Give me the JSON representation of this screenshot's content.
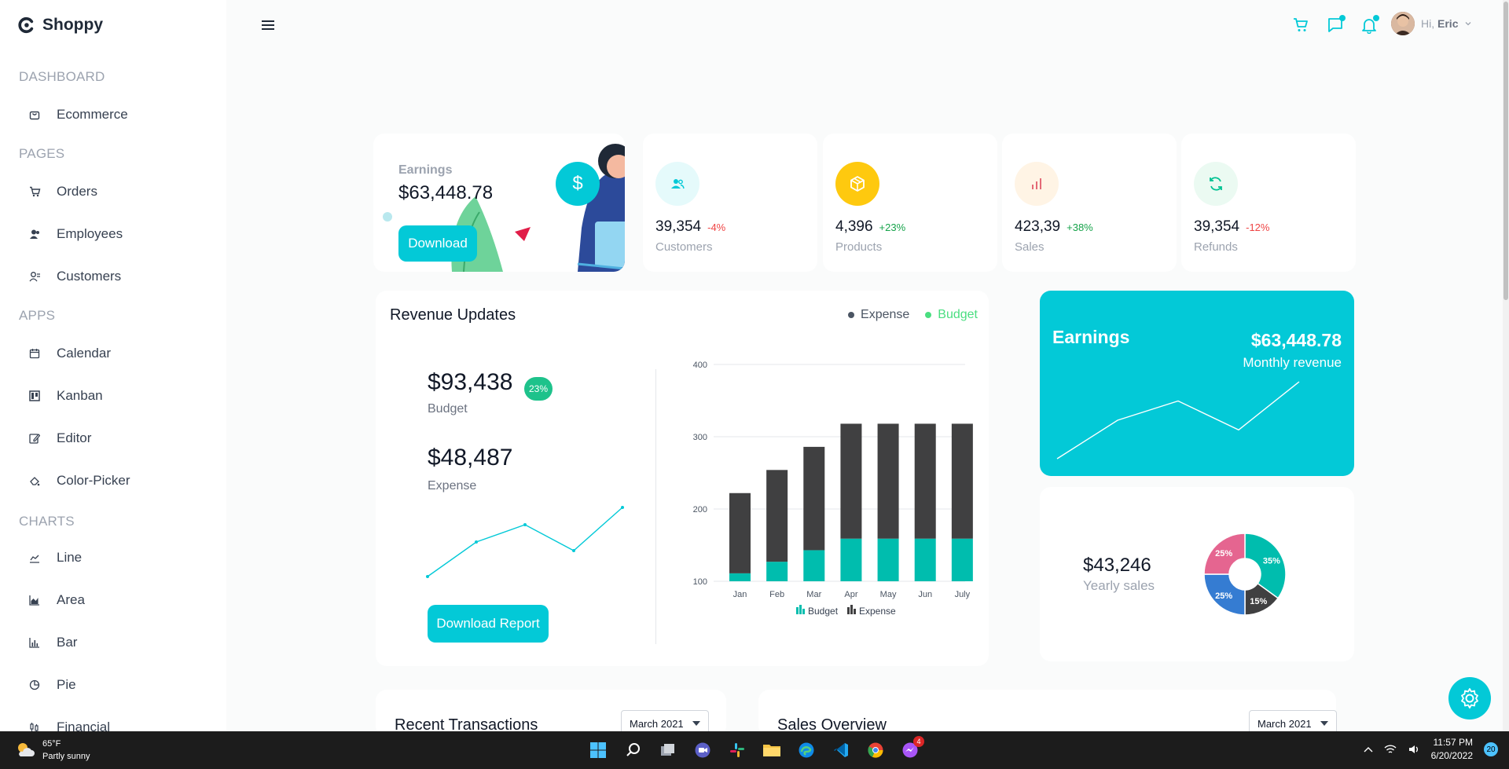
{
  "app": {
    "name": "Shoppy",
    "accent": "#03c9d7"
  },
  "sidebar": {
    "sections": [
      {
        "title": "DASHBOARD",
        "items": [
          {
            "label": "Ecommerce",
            "icon": "shopping-bag-icon"
          }
        ]
      },
      {
        "title": "PAGES",
        "items": [
          {
            "label": "Orders",
            "icon": "cart-icon"
          },
          {
            "label": "Employees",
            "icon": "employees-icon"
          },
          {
            "label": "Customers",
            "icon": "customers-icon"
          }
        ]
      },
      {
        "title": "APPS",
        "items": [
          {
            "label": "Calendar",
            "icon": "calendar-icon"
          },
          {
            "label": "Kanban",
            "icon": "kanban-icon"
          },
          {
            "label": "Editor",
            "icon": "editor-icon"
          },
          {
            "label": "Color-Picker",
            "icon": "color-picker-icon"
          }
        ]
      },
      {
        "title": "CHARTS",
        "items": [
          {
            "label": "Line",
            "icon": "line-chart-icon"
          },
          {
            "label": "Area",
            "icon": "area-chart-icon"
          },
          {
            "label": "Bar",
            "icon": "bar-chart-icon"
          },
          {
            "label": "Pie",
            "icon": "pie-chart-icon"
          },
          {
            "label": "Financial",
            "icon": "financial-icon"
          }
        ]
      }
    ]
  },
  "topbar": {
    "greeting": "Hi,",
    "user": "Eric"
  },
  "earnings": {
    "label": "Earnings",
    "value": "$63,448.78",
    "button": "Download",
    "icon_symbol": "$"
  },
  "stats": [
    {
      "value": "39,354",
      "pct": "-4%",
      "pct_color": "#ef4444",
      "label": "Customers",
      "icon": "customers-icon",
      "icon_color": "#03c9d7",
      "icon_bg": "#e5fafb"
    },
    {
      "value": "4,396",
      "pct": "+23%",
      "pct_color": "#16a34a",
      "label": "Products",
      "icon": "box-icon",
      "icon_color": "#ffffff",
      "icon_bg": "#fec90f"
    },
    {
      "value": "423,39",
      "pct": "+38%",
      "pct_color": "#16a34a",
      "label": "Sales",
      "icon": "bar-stats-icon",
      "icon_color": "#e46a76",
      "icon_bg": "#fff4e5"
    },
    {
      "value": "39,354",
      "pct": "-12%",
      "pct_color": "#ef4444",
      "label": "Refunds",
      "icon": "refresh-icon",
      "icon_color": "#00c292",
      "icon_bg": "#ebfaf2"
    }
  ],
  "revenue": {
    "title": "Revenue Updates",
    "legend_expense": "Expense",
    "legend_budget": "Budget",
    "budget_value": "$93,438",
    "budget_badge": "23%",
    "budget_label": "Budget",
    "expense_value": "$48,487",
    "expense_label": "Expense",
    "report_button": "Download Report"
  },
  "chart_data": [
    {
      "type": "bar",
      "stacked": true,
      "categories": [
        "Jan",
        "Feb",
        "Mar",
        "Apr",
        "May",
        "Jun",
        "July"
      ],
      "series": [
        {
          "name": "Budget",
          "values": [
            111,
            127,
            143,
            159,
            159,
            159,
            159
          ],
          "color": "#00bdae"
        },
        {
          "name": "Expense",
          "values": [
            111,
            127,
            143,
            159,
            159,
            159,
            159
          ],
          "color": "#404041"
        }
      ],
      "yticks": [
        100,
        200,
        300,
        400
      ],
      "ylim": [
        100,
        400
      ],
      "legend": "bottom"
    },
    {
      "type": "line",
      "series": [
        {
          "values": [
            2,
            6,
            8,
            5,
            10
          ],
          "color": "#03c9d7"
        }
      ]
    },
    {
      "type": "line",
      "series": [
        {
          "values": [
            2,
            6,
            8,
            5,
            10
          ],
          "color": "#ffffff"
        }
      ]
    },
    {
      "type": "pie",
      "slices": [
        {
          "label": "35%",
          "value": 35,
          "color": "#00bdae"
        },
        {
          "label": "15%",
          "value": 15,
          "color": "#404041"
        },
        {
          "label": "25%",
          "value": 25,
          "color": "#357cd2"
        },
        {
          "label": "25%",
          "value": 25,
          "color": "#e56590"
        }
      ]
    }
  ],
  "earnings_card2": {
    "title": "Earnings",
    "value": "$63,448.78",
    "sub": "Monthly revenue"
  },
  "yearly": {
    "value": "$43,246",
    "label": "Yearly sales"
  },
  "bottom": {
    "transactions_title": "Recent Transactions",
    "transactions_select": "March 2021",
    "sales_title": "Sales Overview",
    "sales_select": "March 2021"
  },
  "taskbar": {
    "temp": "65°F",
    "weather": "Partly sunny",
    "time": "11:57 PM",
    "date": "6/20/2022",
    "notifications": "20",
    "messenger_badge": "4"
  }
}
